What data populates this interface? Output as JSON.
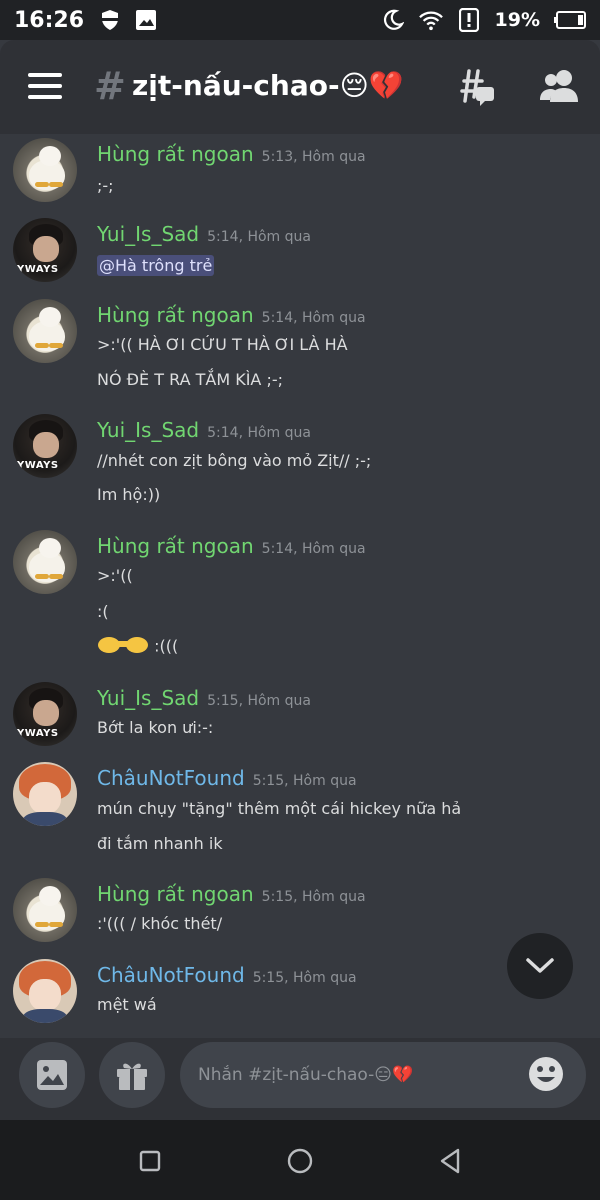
{
  "status_bar": {
    "time": "16:26",
    "battery": "19%"
  },
  "header": {
    "hash": "#",
    "channel_name": "zịt-nấu-chao-😔💔"
  },
  "colors": {
    "username_green": "#71d671",
    "username_blue": "#6fb8e8",
    "background": "#36393f",
    "mention_bg": "#4a4f7a"
  },
  "messages": [
    {
      "user": "Hùng rất ngoan",
      "time": "5:13, Hôm qua",
      "lines": [
        ";-;"
      ]
    },
    {
      "user": "Yui_Is_Sad",
      "time": "5:14, Hôm qua",
      "lines": [
        "@Hà trông trẻ"
      ]
    },
    {
      "user": "Hùng rất ngoan",
      "time": "5:14, Hôm qua",
      "lines": [
        ">:'(( HÀ ƠI CỨU T HÀ ƠI LÀ HÀ",
        "NÓ ĐÈ T RA TẮM KÌA ;-;"
      ]
    },
    {
      "user": "Yui_Is_Sad",
      "time": "5:14, Hôm qua",
      "lines": [
        "//nhét con zịt bông vào mỏ Zịt// ;-;",
        "Im hộ:))"
      ]
    },
    {
      "user": "Hùng rất ngoan",
      "time": "5:14, Hôm qua",
      "lines": [
        ">:'((",
        ":(",
        ":((("
      ]
    },
    {
      "user": "Yui_Is_Sad",
      "time": "5:15, Hôm qua",
      "lines": [
        "Bớt la kon ưi:-:"
      ]
    },
    {
      "user": "ChâuNotFound",
      "time": "5:15, Hôm qua",
      "lines": [
        "mún chụy \"tặng\" thêm một cái hickey nữa hả",
        "đi tắm nhanh ik"
      ]
    },
    {
      "user": "Hùng rất ngoan",
      "time": "5:15, Hôm qua",
      "lines": [
        ":'((( / khóc thét/"
      ]
    },
    {
      "user": "ChâuNotFound",
      "time": "5:15, Hôm qua",
      "lines": [
        "mệt wá"
      ]
    }
  ],
  "composer": {
    "placeholder": "Nhắn #zịt-nấu-chao-😑💔"
  }
}
